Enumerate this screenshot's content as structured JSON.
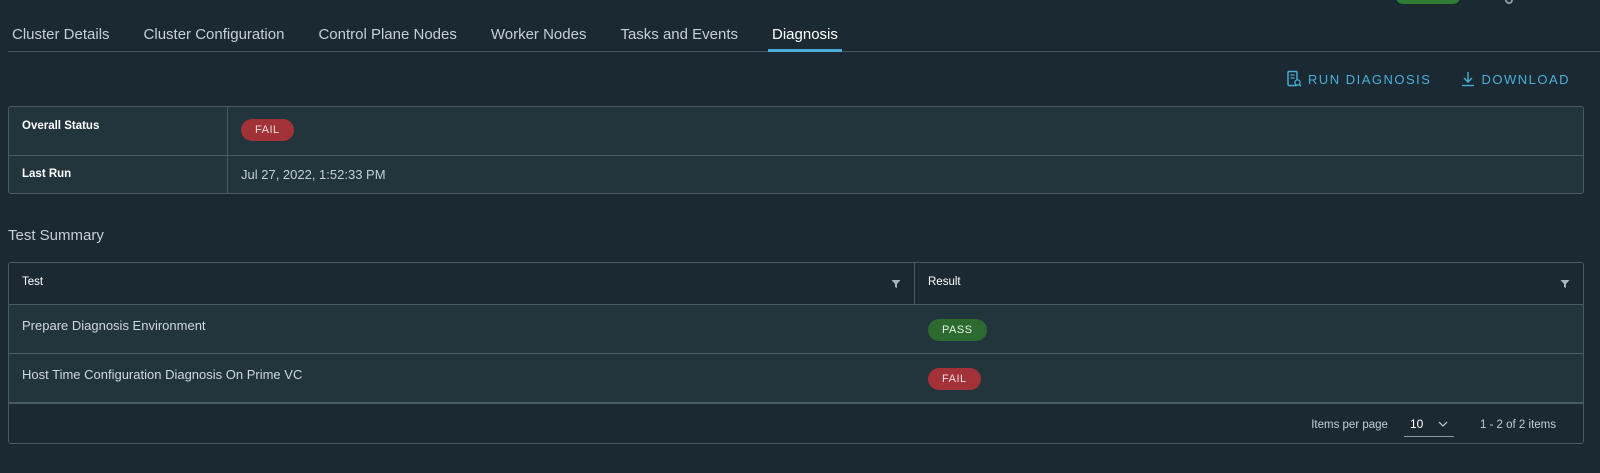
{
  "tabs": [
    {
      "label": "Cluster Details"
    },
    {
      "label": "Cluster Configuration"
    },
    {
      "label": "Control Plane Nodes"
    },
    {
      "label": "Worker Nodes"
    },
    {
      "label": "Tasks and Events"
    },
    {
      "label": "Diagnosis"
    }
  ],
  "active_tab": "Diagnosis",
  "actions": {
    "run_diagnosis": "RUN DIAGNOSIS",
    "download": "DOWNLOAD"
  },
  "status": {
    "overall_label": "Overall Status",
    "overall_value": "FAIL",
    "last_run_label": "Last Run",
    "last_run_value": "Jul 27, 2022, 1:52:33 PM"
  },
  "test_summary": {
    "title": "Test Summary",
    "columns": [
      "Test",
      "Result"
    ],
    "rows": [
      {
        "test": "Prepare Diagnosis Environment",
        "result": "PASS"
      },
      {
        "test": "Host Time Configuration Diagnosis On Prime VC",
        "result": "FAIL"
      }
    ],
    "footer": {
      "items_per_page_label": "Items per page",
      "items_per_page_value": "10",
      "range_text": "1 - 2 of 2 items"
    }
  },
  "colors": {
    "background": "#1b2a32",
    "accent": "#49afd9",
    "fail": "#a23237",
    "pass": "#2c6a2f"
  }
}
